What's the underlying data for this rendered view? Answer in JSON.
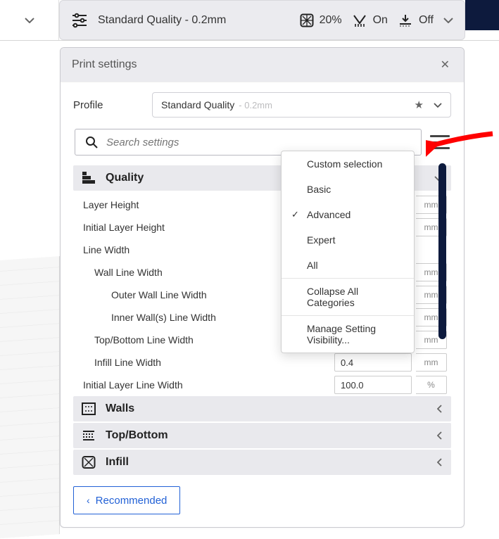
{
  "topbar": {
    "profile_summary": "Standard Quality - 0.2mm",
    "infill_pct": "20%",
    "support_state": "On",
    "adhesion_state": "Off"
  },
  "panel": {
    "title": "Print settings",
    "profile_label": "Profile",
    "profile_name": "Standard Quality",
    "profile_suffix": "- 0.2mm",
    "search_placeholder": "Search settings",
    "recommended_label": "Recommended"
  },
  "quality": {
    "name": "Quality",
    "settings": [
      {
        "label": "Layer Height",
        "indent": 1,
        "value": "",
        "unit": "mm"
      },
      {
        "label": "Initial Layer Height",
        "indent": 1,
        "value": "",
        "unit": "mm"
      },
      {
        "label": "Line Width",
        "indent": 1,
        "value": null,
        "unit": null
      },
      {
        "label": "Wall Line Width",
        "indent": 2,
        "value": "",
        "unit": "mm"
      },
      {
        "label": "Outer Wall Line Width",
        "indent": 3,
        "value": "",
        "unit": "mm"
      },
      {
        "label": "Inner Wall(s) Line Width",
        "indent": 3,
        "value": "",
        "unit": "mm"
      },
      {
        "label": "Top/Bottom Line Width",
        "indent": 2,
        "value": "",
        "unit": "mm"
      },
      {
        "label": "Infill Line Width",
        "indent": 2,
        "value": "0.4",
        "unit": "mm"
      },
      {
        "label": "Initial Layer Line Width",
        "indent": 1,
        "value": "100.0",
        "unit": "%"
      }
    ]
  },
  "collapsed_categories": [
    {
      "name": "Walls",
      "icon": "walls"
    },
    {
      "name": "Top/Bottom",
      "icon": "topbottom"
    },
    {
      "name": "Infill",
      "icon": "infill"
    }
  ],
  "visibility_menu": {
    "items": [
      {
        "label": "Custom selection",
        "checked": false
      },
      {
        "label": "Basic",
        "checked": false
      },
      {
        "label": "Advanced",
        "checked": true
      },
      {
        "label": "Expert",
        "checked": false
      },
      {
        "label": "All",
        "checked": false
      }
    ],
    "collapse_label": "Collapse All Categories",
    "manage_label": "Manage Setting Visibility..."
  }
}
